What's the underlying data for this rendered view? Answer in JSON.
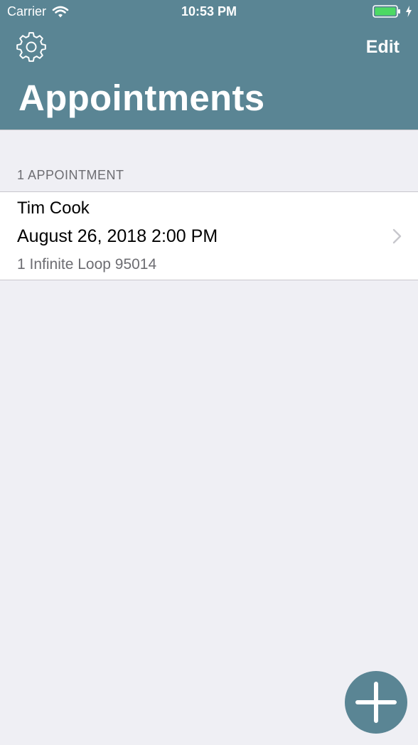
{
  "status_bar": {
    "carrier": "Carrier",
    "time": "10:53 PM",
    "battery_icon": "battery-charging-icon"
  },
  "nav": {
    "settings_icon": "gear-icon",
    "edit_label": "Edit",
    "title": "Appointments",
    "color": "#5a8594"
  },
  "section": {
    "header": "1 APPOINTMENT"
  },
  "appointments": [
    {
      "name": "Tim Cook",
      "datetime": "August 26, 2018 2:00 PM",
      "address": "1 Infinite Loop 95014"
    }
  ],
  "fab": {
    "icon": "plus-icon"
  }
}
